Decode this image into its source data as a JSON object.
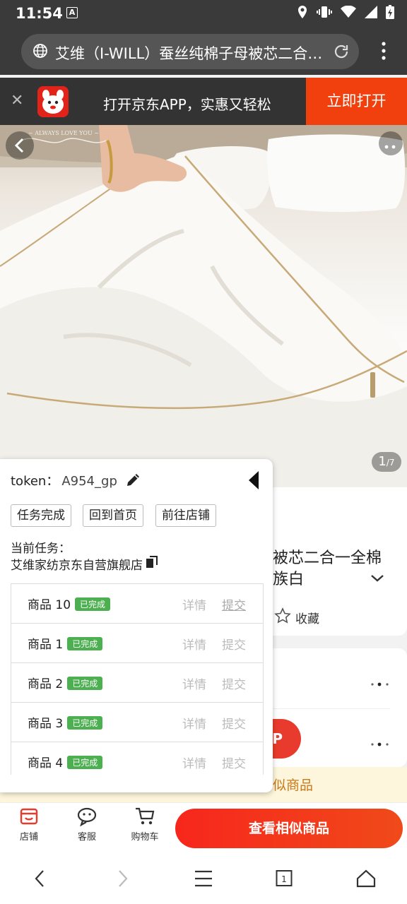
{
  "status_bar": {
    "time": "11:54",
    "a_icon": "A"
  },
  "browser": {
    "url_title": "艾维（I-WILL）蚕丝纯棉子母被芯二合一全棉"
  },
  "app_banner": {
    "text": "打开京东APP，实惠又轻松",
    "open_label": "立即打开"
  },
  "gallery": {
    "current": "1",
    "total": "/7",
    "watermark": "ALWAYS LOVE YOU"
  },
  "product": {
    "title_line1": "被芯二合一全棉",
    "title_line2": "族白",
    "favorite_label": "收藏",
    "red_pill_label": "P",
    "similar_strip": "似商品"
  },
  "bottom_bar": {
    "shop": "店铺",
    "service": "客服",
    "cart": "购物车",
    "similar_button": "查看相似商品"
  },
  "task_panel": {
    "token_label": "token：",
    "token_value": "A954_gp",
    "buttons": [
      "任务完成",
      "回到首页",
      "前往店铺"
    ],
    "current_task_label": "当前任务：",
    "current_task_name": "艾维家纺京东自营旗舰店",
    "detail_label": "详情",
    "submit_label": "提交",
    "done_badge": "已完成",
    "items": [
      {
        "name": "商品 10"
      },
      {
        "name": "商品 1"
      },
      {
        "name": "商品 2"
      },
      {
        "name": "商品 3"
      },
      {
        "name": "商品 4"
      }
    ]
  },
  "colors": {
    "jd_red": "#e2231a",
    "open_orange": "#f1400e",
    "done_green": "#4caf50",
    "status_dark": "#3a3a3a"
  }
}
